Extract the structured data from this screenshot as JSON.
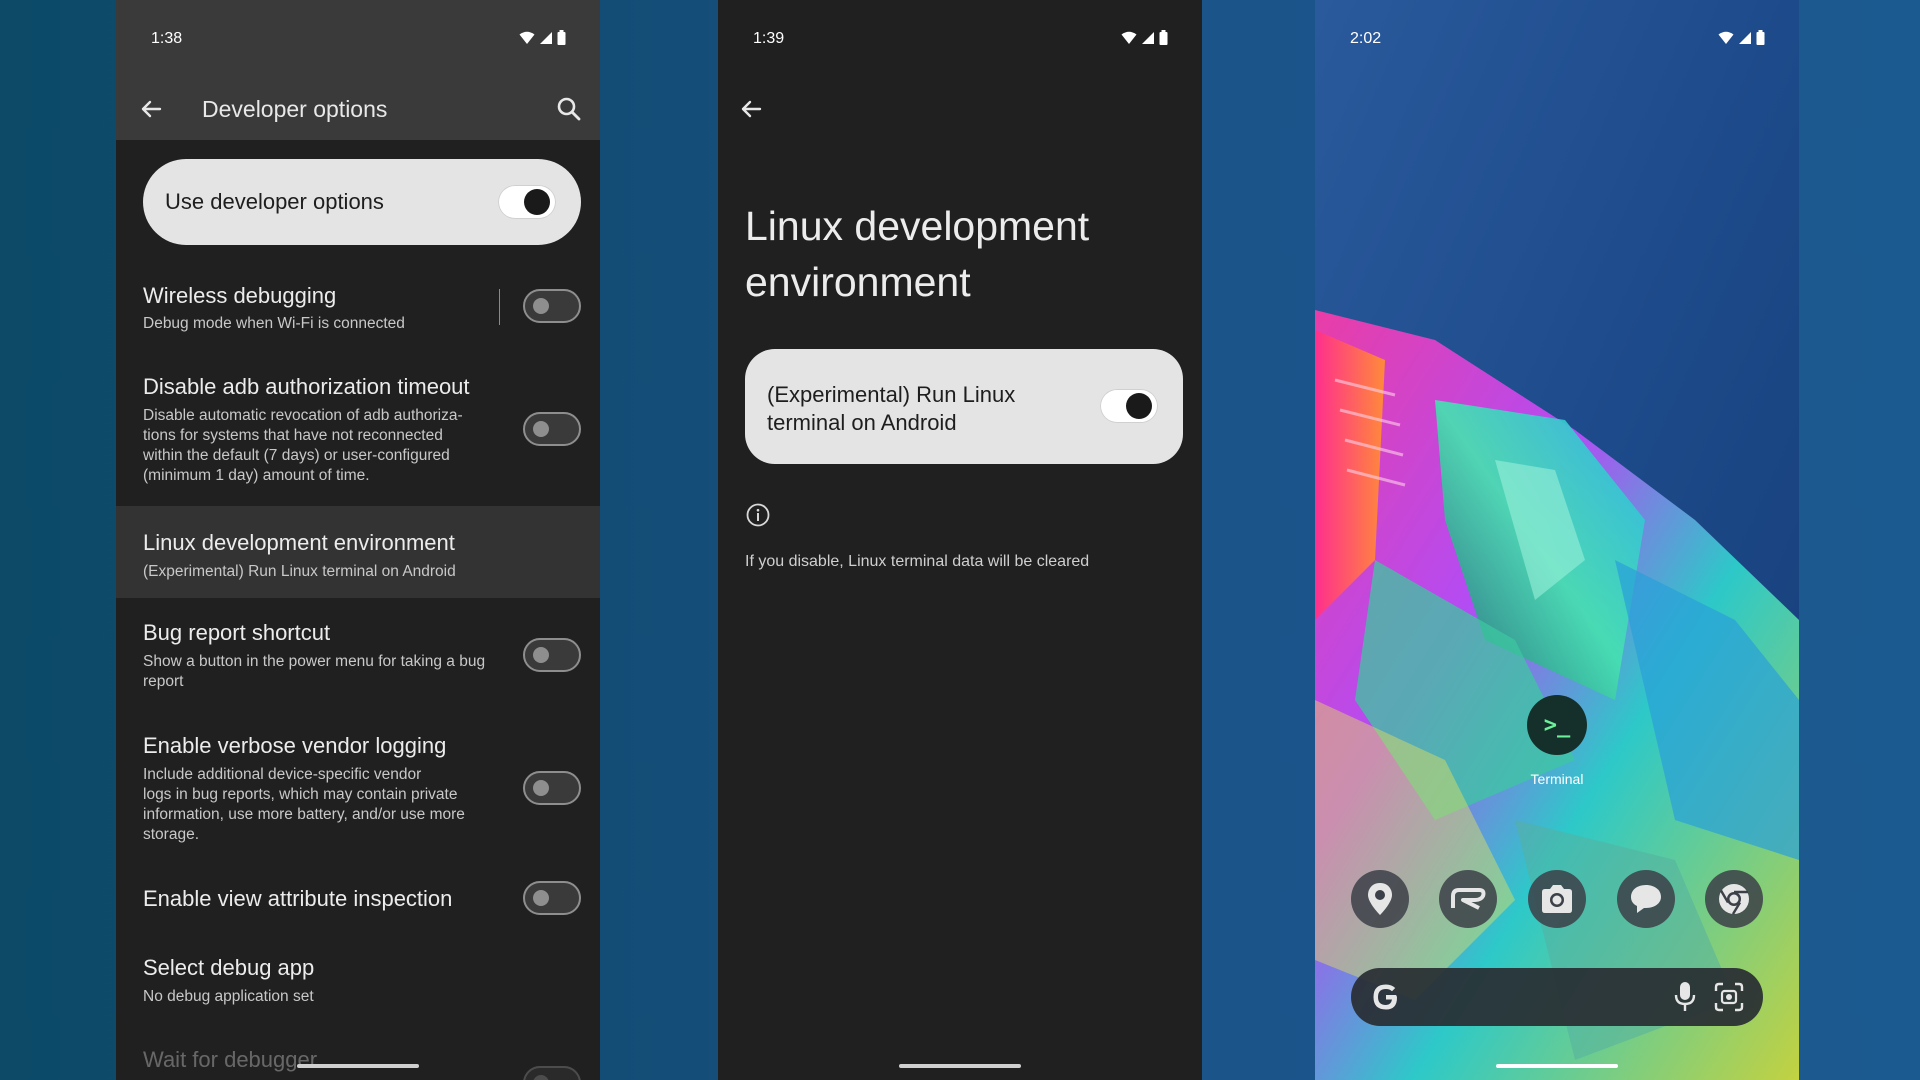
{
  "phone1": {
    "time": "1:38",
    "title": "Developer options",
    "main_toggle": {
      "label": "Use developer options",
      "state": "on"
    },
    "settings": [
      {
        "title": "Wireless debugging",
        "summary": "Debug mode when Wi-Fi is connected",
        "state": "off"
      },
      {
        "title": "Disable adb authorization timeout",
        "summary": "Disable automatic revocation of adb authoriza-tions for systems that have not reconnected within the default (7 days) or user-configured (minimum 1 day) amount of time.",
        "summary_lines": [
          "Disable automatic revocation of adb authoriza-",
          "tions for systems that have not reconnected",
          "within the default (7 days) or user-configured",
          "(minimum 1 day) amount of time."
        ],
        "state": "off"
      },
      {
        "title": "Linux development environment",
        "summary": "(Experimental) Run Linux terminal on Android"
      },
      {
        "title": "Bug report shortcut",
        "summary_lines": [
          "Show a button in the power menu for taking a bug",
          "report"
        ],
        "state": "off"
      },
      {
        "title": "Enable verbose vendor logging",
        "summary_lines": [
          "Include additional device-specific vendor",
          "logs in bug reports, which may contain private",
          "information, use more battery, and/or use more",
          "storage."
        ],
        "state": "off"
      },
      {
        "title": "Enable view attribute inspection",
        "state": "off"
      },
      {
        "title": "Select debug app",
        "summary": "No debug application set"
      },
      {
        "title": "Wait for debugger",
        "state": "off"
      }
    ]
  },
  "phone2": {
    "time": "1:39",
    "title": "Linux development environment",
    "toggle": {
      "label": "(Experimental) Run Linux terminal on Android",
      "state": "on"
    },
    "note": "If you disable, Linux terminal data will be cleared"
  },
  "phone3": {
    "time": "2:02",
    "app": {
      "label": "Terminal",
      "glyph": ">_"
    },
    "dock_icons": [
      "maps-icon",
      "rush-app-icon",
      "camera-icon",
      "messages-icon",
      "chrome-icon"
    ]
  },
  "colors": {
    "panel_dark": "#202020",
    "header": "#3a3a3a",
    "card": "#e4e4e4",
    "terminal_green": "#6df09a"
  }
}
